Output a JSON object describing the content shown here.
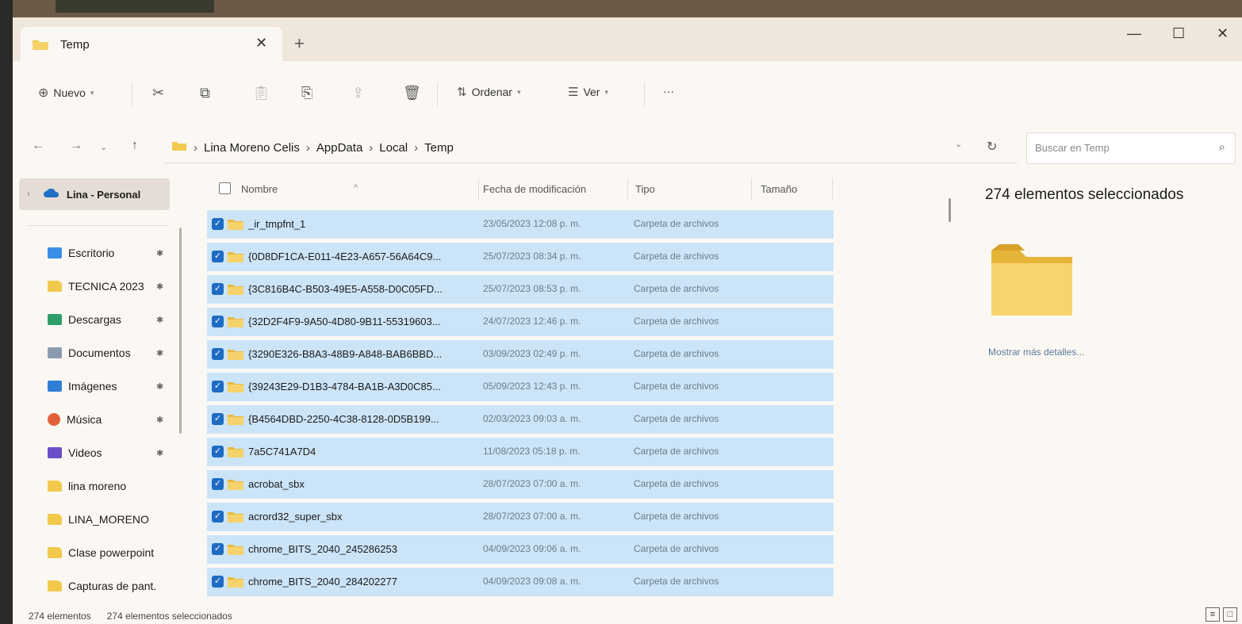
{
  "window": {
    "tab_title": "Temp",
    "tab_close": "✕",
    "new_tab": "+",
    "minimize": "—",
    "maximize": "☐",
    "close": "✕"
  },
  "toolbar": {
    "new_label": "Nuevo",
    "sort_label": "Ordenar",
    "view_label": "Ver",
    "more_label": "···"
  },
  "address": {
    "crumbs": [
      "Lina Moreno Celis",
      "AppData",
      "Local",
      "Temp"
    ],
    "search_placeholder": "Buscar en Temp"
  },
  "sidebar": {
    "top_label": "Lina - Personal",
    "items": [
      {
        "label": "Escritorio",
        "icon": "desktop-icon",
        "color": "#3a8ee6",
        "pinned": true
      },
      {
        "label": "TECNICA 2023",
        "icon": "folder-icon",
        "color": "#f2c94c",
        "pinned": true
      },
      {
        "label": "Descargas",
        "icon": "download-icon",
        "color": "#2e9e6a",
        "pinned": true
      },
      {
        "label": "Documentos",
        "icon": "document-icon",
        "color": "#8a9bb0",
        "pinned": true
      },
      {
        "label": "Imágenes",
        "icon": "image-icon",
        "color": "#2f7fd6",
        "pinned": true
      },
      {
        "label": "Música",
        "icon": "music-icon",
        "color": "#e0603a",
        "pinned": true
      },
      {
        "label": "Videos",
        "icon": "video-icon",
        "color": "#6a4fc9",
        "pinned": true
      },
      {
        "label": "lina moreno",
        "icon": "folder-icon",
        "color": "#f2c94c",
        "pinned": false
      },
      {
        "label": "LINA_MORENO",
        "icon": "folder-icon",
        "color": "#f2c94c",
        "pinned": false
      },
      {
        "label": "Clase powerpoint",
        "icon": "folder-icon",
        "color": "#f2c94c",
        "pinned": false
      },
      {
        "label": "Capturas de pant.",
        "icon": "folder-icon",
        "color": "#f2c94c",
        "pinned": false
      }
    ]
  },
  "columns": {
    "name": "Nombre",
    "date": "Fecha de modificación",
    "type": "Tipo",
    "size": "Tamaño"
  },
  "files": [
    {
      "name": "_ir_tmpfnt_1",
      "date": "23/05/2023 12:08 p. m.",
      "type": "Carpeta de archivos"
    },
    {
      "name": "{0D8DF1CA-E011-4E23-A657-56A64C9...",
      "date": "25/07/2023 08:34 p. m.",
      "type": "Carpeta de archivos"
    },
    {
      "name": "{3C816B4C-B503-49E5-A558-D0C05FD...",
      "date": "25/07/2023 08:53 p. m.",
      "type": "Carpeta de archivos"
    },
    {
      "name": "{32D2F4F9-9A50-4D80-9B11-55319603...",
      "date": "24/07/2023 12:46 p. m.",
      "type": "Carpeta de archivos"
    },
    {
      "name": "{3290E326-B8A3-48B9-A848-BAB6BBD...",
      "date": "03/09/2023 02:49 p. m.",
      "type": "Carpeta de archivos"
    },
    {
      "name": "{39243E29-D1B3-4784-BA1B-A3D0C85...",
      "date": "05/09/2023 12:43 p. m.",
      "type": "Carpeta de archivos"
    },
    {
      "name": "{B4564DBD-2250-4C38-8128-0D5B199...",
      "date": "02/03/2023 09:03 a. m.",
      "type": "Carpeta de archivos"
    },
    {
      "name": "7a5C741A7D4",
      "date": "11/08/2023 05:18 p. m.",
      "type": "Carpeta de archivos"
    },
    {
      "name": "acrobat_sbx",
      "date": "28/07/2023 07:00 a. m.",
      "type": "Carpeta de archivos"
    },
    {
      "name": "acrord32_super_sbx",
      "date": "28/07/2023 07:00 a. m.",
      "type": "Carpeta de archivos"
    },
    {
      "name": "chrome_BITS_2040_245286253",
      "date": "04/09/2023 09:06 a. m.",
      "type": "Carpeta de archivos"
    },
    {
      "name": "chrome_BITS_2040_284202277",
      "date": "04/09/2023 09:08 a. m.",
      "type": "Carpeta de archivos"
    }
  ],
  "details": {
    "selected_count": "274 elementos seleccionados",
    "more_details": "Mostrar más detalles..."
  },
  "status": {
    "item_count": "274 elementos",
    "selected_count": "274 elementos seleccionados"
  }
}
